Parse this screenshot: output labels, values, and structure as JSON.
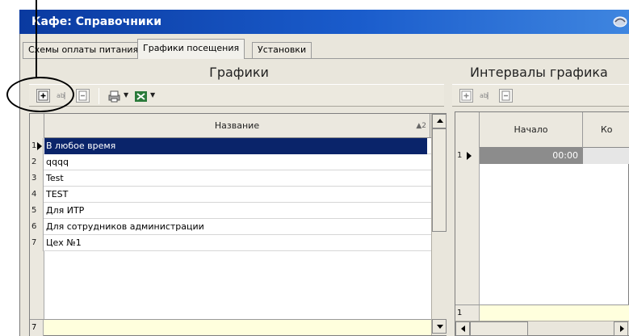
{
  "window": {
    "title": "Кафе: Справочники",
    "titlebar_color": "#0a3aa0"
  },
  "tabs": [
    {
      "label": "Схемы оплаты питания",
      "active": false
    },
    {
      "label": "Графики посещения",
      "active": true
    },
    {
      "label": "Установки",
      "active": false
    }
  ],
  "left_panel": {
    "title": "Графики",
    "toolbar": {
      "add_icon": "add-record-icon",
      "rename_icon": "rename-icon",
      "delete_icon": "delete-icon",
      "print_icon": "print-icon",
      "excel_icon": "excel-export-icon"
    },
    "column": {
      "label": "Название",
      "sort_indicator": "2"
    },
    "rows": [
      {
        "num": "1",
        "name": "В любое время",
        "selected": true
      },
      {
        "num": "2",
        "name": "qqqq",
        "selected": false
      },
      {
        "num": "3",
        "name": "Test",
        "selected": false
      },
      {
        "num": "4",
        "name": "TEST",
        "selected": false
      },
      {
        "num": "5",
        "name": "Для ИТР",
        "selected": false
      },
      {
        "num": "6",
        "name": "Для сотрудников администрации",
        "selected": false
      },
      {
        "num": "7",
        "name": "Цех №1",
        "selected": false
      }
    ],
    "footer_count": "7"
  },
  "right_panel": {
    "title": "Интервалы графика",
    "columns": {
      "start": "Начало",
      "end": "Ко"
    },
    "rows": [
      {
        "num": "1",
        "start": "00:00"
      }
    ],
    "footer_count": "1"
  },
  "colors": {
    "selection": "#0a246a",
    "footer_bg": "#ffffdd"
  }
}
